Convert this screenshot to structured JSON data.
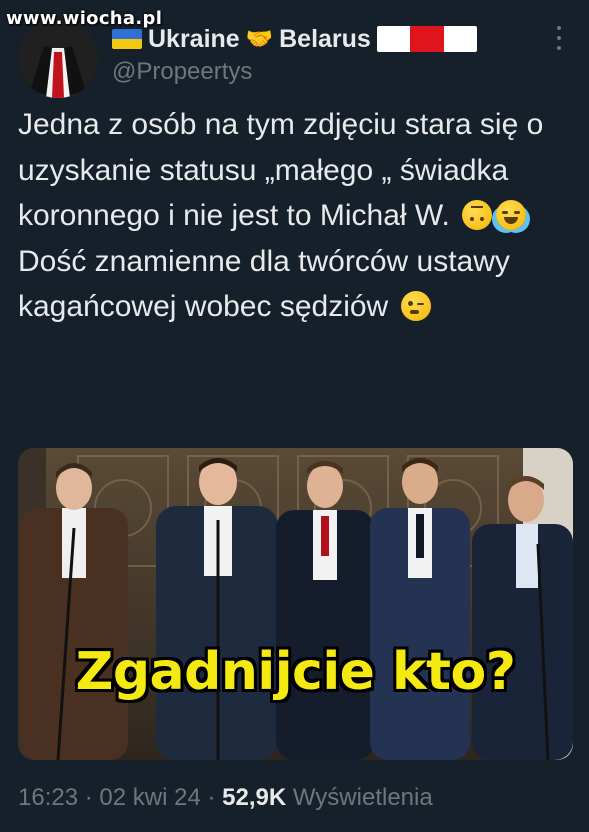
{
  "watermark": "www.wiocha.pl",
  "author": {
    "name_left": "Ukraine",
    "name_right": "Belarus",
    "handle": "@Propeertys",
    "icons": [
      "ukraine-flag-icon",
      "handshake-icon",
      "belarus-flag-icon"
    ]
  },
  "tweet": {
    "lines_1": "Jedna z osób na tym zdjęciu stara się o uzyskanie statusu „małego „ świadka koronnego i nie jest to Michał W.",
    "lines_2": "Dość znamienne dla twórców ustawy kagańcowej wobec sędziów",
    "emojis_1": [
      "upside-down-face-emoji",
      "face-with-tears-of-joy-emoji"
    ],
    "emojis_2": [
      "winking-face-emoji"
    ]
  },
  "media": {
    "caption": "Zgadnijcie kto?"
  },
  "meta": {
    "time": "16:23",
    "sep1": "·",
    "date": "02 kwi 24",
    "sep2": "·",
    "views_count": "52,9K",
    "views_label": "Wyświetlenia"
  },
  "colors": {
    "background": "#15202b",
    "text": "#e7e9ea",
    "muted": "#71767b",
    "caption": "#f4ea12"
  }
}
